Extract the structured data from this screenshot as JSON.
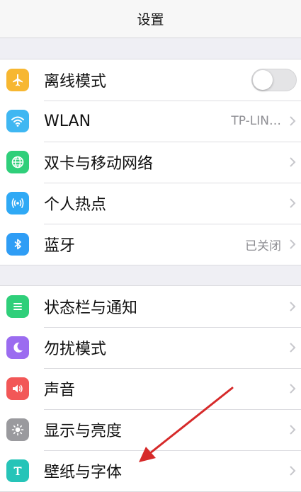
{
  "header": {
    "title": "设置"
  },
  "colors": {
    "airplane": "#f7b731",
    "wlan": "#3fb7f2",
    "network": "#2fcf7a",
    "hotspot": "#2fa9f5",
    "bluetooth": "#2f9df5",
    "statusbar": "#2fcf7a",
    "dnd": "#9b6cf0",
    "sound": "#f25757",
    "display": "#9a9a9e",
    "wallpaper": "#26c4b8",
    "annotation": "#d62a2a"
  },
  "groups": [
    {
      "items": [
        {
          "label": "离线模式",
          "icon": "airplane-icon",
          "control": "toggle",
          "toggle_on": false
        },
        {
          "label": "WLAN",
          "icon": "wifi-icon",
          "value": "TP-LIN…",
          "control": "chevron"
        },
        {
          "label": "双卡与移动网络",
          "icon": "globe-icon",
          "control": "chevron"
        },
        {
          "label": "个人热点",
          "icon": "hotspot-icon",
          "control": "chevron"
        },
        {
          "label": "蓝牙",
          "icon": "bluetooth-icon",
          "value": "已关闭",
          "control": "chevron"
        }
      ]
    },
    {
      "items": [
        {
          "label": "状态栏与通知",
          "icon": "list-icon",
          "control": "chevron"
        },
        {
          "label": "勿扰模式",
          "icon": "moon-icon",
          "control": "chevron"
        },
        {
          "label": "声音",
          "icon": "speaker-icon",
          "control": "chevron"
        },
        {
          "label": "显示与亮度",
          "icon": "brightness-icon",
          "control": "chevron"
        },
        {
          "label": "壁纸与字体",
          "icon": "font-t-icon",
          "control": "chevron"
        }
      ]
    }
  ]
}
